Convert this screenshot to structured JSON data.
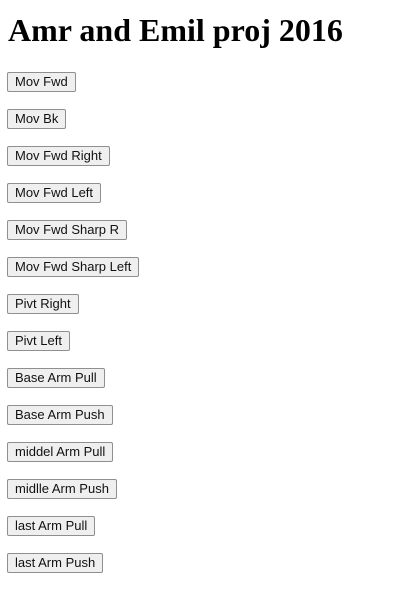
{
  "page": {
    "title": "Amr and Emil proj 2016"
  },
  "buttons": [
    {
      "label": "Mov Fwd"
    },
    {
      "label": "Mov Bk"
    },
    {
      "label": "Mov Fwd Right"
    },
    {
      "label": "Mov Fwd Left"
    },
    {
      "label": "Mov Fwd Sharp R"
    },
    {
      "label": "Mov Fwd Sharp Left"
    },
    {
      "label": "Pivt Right"
    },
    {
      "label": "Pivt Left"
    },
    {
      "label": "Base Arm Pull"
    },
    {
      "label": "Base Arm Push"
    },
    {
      "label": "middel Arm Pull"
    },
    {
      "label": "midlle Arm Push"
    },
    {
      "label": "last Arm Pull"
    },
    {
      "label": "last Arm Push"
    }
  ]
}
